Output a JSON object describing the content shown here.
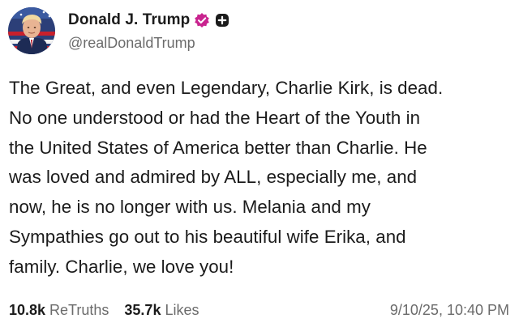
{
  "author": {
    "display_name": "Donald J. Trump",
    "handle": "@realDonaldTrump",
    "avatar_icon": "avatar-image",
    "verified_icon": "verified-badge-icon",
    "extra_badge_icon": "plus-badge-icon",
    "verified_color": "#c9248f"
  },
  "post": {
    "text": "The Great, and even Legendary, Charlie Kirk, is dead.\nNo one understood or had the Heart of the Youth in\nthe United States of America better than Charlie. He\nwas loved and admired by ALL, especially me, and\nnow, he is no longer with us. Melania and my\nSympathies go out to his beautiful wife Erika, and\nfamily. Charlie, we love you!"
  },
  "stats": {
    "retruths_count": "10.8k",
    "retruths_label": "ReTruths",
    "likes_count": "35.7k",
    "likes_label": "Likes"
  },
  "timestamp": "9/10/25, 10:40 PM"
}
